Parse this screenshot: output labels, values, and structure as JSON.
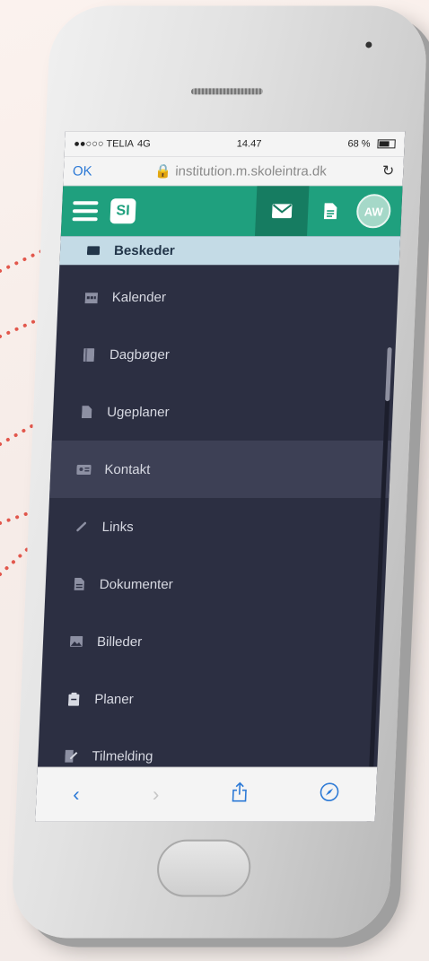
{
  "status_bar": {
    "carrier": "●●○○○ TELIA",
    "network": "4G",
    "time": "14.47",
    "battery": "68 %"
  },
  "browser": {
    "ok_label": "OK",
    "url": "🔒 institution.m.skoleintra.dk",
    "reload_icon": "↻"
  },
  "header": {
    "logo_text": "SI",
    "avatar_initials": "AW"
  },
  "menu": {
    "items": [
      {
        "label": "Beskeder",
        "icon": "envelope-icon"
      },
      {
        "label": "Kalender",
        "icon": "calendar-icon"
      },
      {
        "label": "Dagbøger",
        "icon": "book-icon"
      },
      {
        "label": "Ugeplaner",
        "icon": "document-icon"
      },
      {
        "label": "Kontakt",
        "icon": "contact-card-icon"
      },
      {
        "label": "Links",
        "icon": "link-icon"
      },
      {
        "label": "Dokumenter",
        "icon": "file-icon"
      },
      {
        "label": "Billeder",
        "icon": "image-icon"
      },
      {
        "label": "Planer",
        "icon": "clipboard-icon"
      },
      {
        "label": "Tilmelding",
        "icon": "signup-icon"
      }
    ]
  },
  "colors": {
    "brand": "#1fa07e",
    "brand_dark": "#167c61",
    "menu_bg": "#2c2f42",
    "active_bg": "#c4dbe6",
    "dots": "#e2574c"
  }
}
